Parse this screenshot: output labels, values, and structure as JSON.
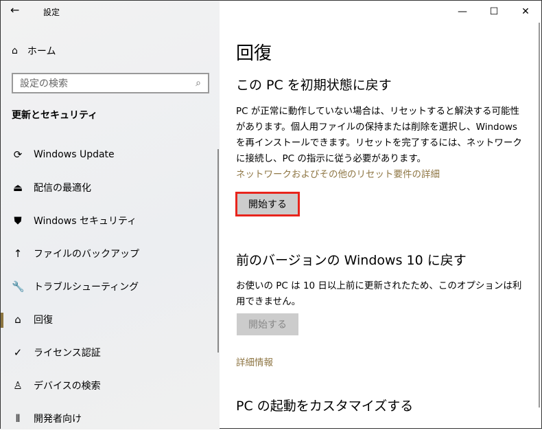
{
  "window": {
    "title": "設定",
    "back": "←",
    "minimize": "—",
    "maximize": "☐",
    "close": "✕"
  },
  "sidebar": {
    "home": "ホーム",
    "search_placeholder": "設定の検索",
    "section": "更新とセキュリティ",
    "items": [
      {
        "label": "Windows Update",
        "icon": "⟳"
      },
      {
        "label": "配信の最適化",
        "icon": "⏏"
      },
      {
        "label": "Windows セキュリティ",
        "icon": "⛊"
      },
      {
        "label": "ファイルのバックアップ",
        "icon": "↑"
      },
      {
        "label": "トラブルシューティング",
        "icon": "🔧"
      },
      {
        "label": "回復",
        "icon": "⌂"
      },
      {
        "label": "ライセンス認証",
        "icon": "✓"
      },
      {
        "label": "デバイスの検索",
        "icon": "♙"
      },
      {
        "label": "開発者向け",
        "icon": "⫴"
      }
    ]
  },
  "main": {
    "title": "回復",
    "reset": {
      "heading": "この PC を初期状態に戻す",
      "body": "PC が正常に動作していない場合は、リセットすると解決する可能性があります。個人用ファイルの保持または削除を選択し、Windows を再インストールできます。リセットを完了するには、ネットワークに接続し、PC の指示に従う必要があります。",
      "link": "ネットワークおよびその他のリセット要件の詳細",
      "button": "開始する"
    },
    "rollback": {
      "heading": "前のバージョンの Windows 10 に戻す",
      "body": "お使いの PC は 10 日以上前に更新されたため、このオプションは利用できません。",
      "button": "開始する",
      "link": "詳細情報"
    },
    "startup": {
      "heading": "PC の起動をカスタマイズする"
    }
  }
}
